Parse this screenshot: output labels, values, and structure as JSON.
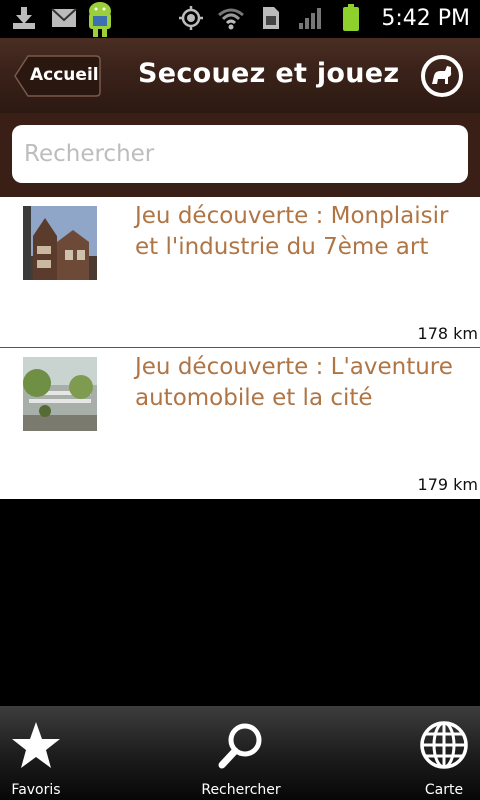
{
  "status_bar": {
    "time": "5:42 PM"
  },
  "header": {
    "back_label": "Accueil",
    "title": "Secouez et jouez"
  },
  "search": {
    "placeholder": "Rechercher",
    "value": ""
  },
  "items": [
    {
      "title": "Jeu découverte : Monplaisir et l'industrie du 7ème art",
      "distance": "178 km"
    },
    {
      "title": "Jeu découverte : L'aventure automobile et la cité",
      "distance": "179 km"
    }
  ],
  "tabs": [
    {
      "label": "Favoris",
      "icon": "star-icon"
    },
    {
      "label": "Rechercher",
      "icon": "magnifier-icon"
    },
    {
      "label": "Carte",
      "icon": "globe-icon"
    }
  ],
  "colors": {
    "header": "#3b231a",
    "item_title": "#b07545",
    "battery": "#8fd12c"
  }
}
